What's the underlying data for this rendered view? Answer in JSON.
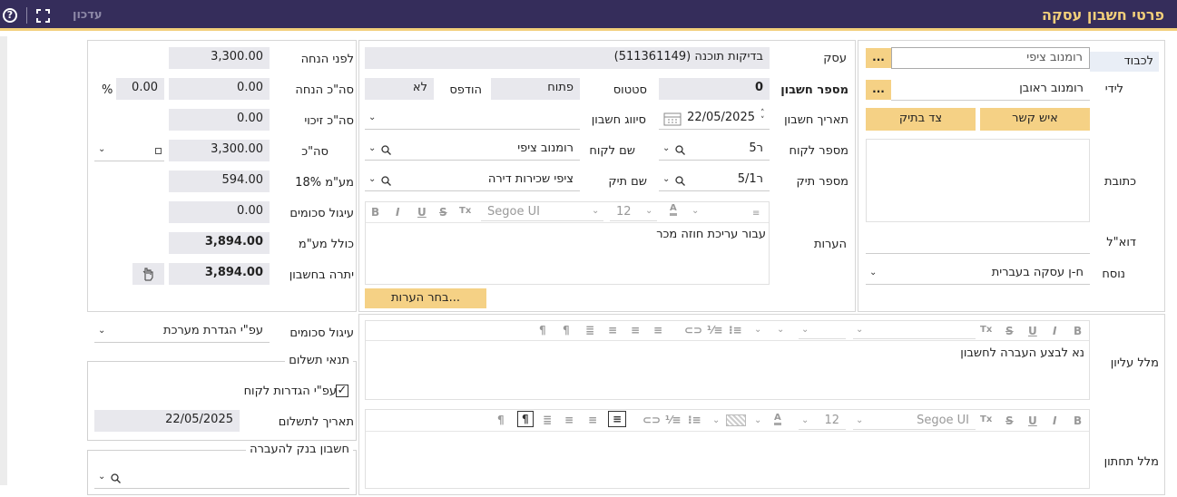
{
  "header": {
    "title": "פרטי חשבון עסקה",
    "update_label": "עדכון",
    "help_glyph": "?"
  },
  "client_panel": {
    "to_label": "לכבוד",
    "to_value": "רומנוב ציפי",
    "attn_label": "לידי",
    "attn_value": "רומנוב ראובן",
    "contact_button": "איש קשר",
    "party_button": "צד בתיק",
    "address_label": "כתובת",
    "email_label": "דוא\"ל",
    "template_label": "נוסח",
    "template_value": "ח-ן עסקה בעברית",
    "dots": "..."
  },
  "deal_panel": {
    "deal_label": "עסק",
    "deal_value": "בדיקות תוכנה (511361149)",
    "account_no_label": "מספר חשבון",
    "account_no_value": "0",
    "status_label": "סטטוס",
    "status_value": "פתוח",
    "printed_label": "הודפס",
    "printed_value": "לא",
    "date_label": "תאריך חשבון",
    "date_value": "22/05/2025",
    "classification_label": "סיווג חשבון",
    "client_no_label": "מספר לקוח",
    "client_no_value": "ר5",
    "client_name_label": "שם לקוח",
    "client_name_value": "רומנוב ציפי",
    "file_no_label": "מספר תיק",
    "file_no_value": "ר5/1",
    "file_name_label": "שם תיק",
    "file_name_value": "ציפי שכירות דירה",
    "notes_label": "הערות",
    "notes_font": "Segoe UI",
    "notes_size": "12",
    "notes_text": "עבור עריכת חוזה מכר",
    "choose_notes_button": "בחר הערות..."
  },
  "totals_panel": {
    "before_discount_label": "לפני הנחה",
    "before_discount_value": "3,300.00",
    "discount_label": "סה\"כ הנחה",
    "discount_value": "0.00",
    "discount_pct_value": "0.00",
    "pct_sign": "%",
    "credit_label": "סה\"כ זיכוי",
    "credit_value": "0.00",
    "total_label": "סה\"כ",
    "total_value": "3,300.00",
    "vat_label": "מע\"מ 18%",
    "vat_value": "594.00",
    "rounding_label": "עיגול סכומים",
    "rounding_value": "0.00",
    "incl_vat_label": "כולל מע\"מ",
    "incl_vat_value": "3,894.00",
    "balance_label": "יתרה בחשבון",
    "balance_value": "3,894.00"
  },
  "bottom_left": {
    "rounding_label": "עיגול סכומים",
    "rounding_select": "עפ\"י הגדרת מערכת",
    "payment_terms_legend": "תנאי תשלום",
    "by_client_settings_label": "עפ\"י הגדרות לקוח",
    "due_date_label": "תאריך לתשלום",
    "due_date_value": "22/05/2025",
    "bank_legend": "חשבון בנק להעברה"
  },
  "bottom_right": {
    "upper_text_label": "מלל עליון",
    "upper_text_value": "נא לבצע העברה לחשבון",
    "lower_text_label": "מלל תחתון",
    "lower_font": "Segoe UI",
    "lower_size": "12"
  },
  "toolbar_glyphs": {
    "bold": "B",
    "italic": "I",
    "underline": "U",
    "strike": "S",
    "clear": "Tx",
    "font_color": "A"
  }
}
